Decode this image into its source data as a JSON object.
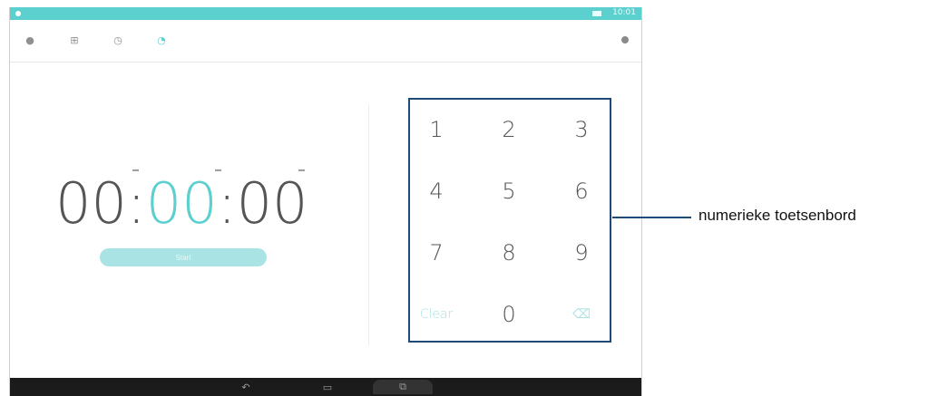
{
  "status_bar": {
    "time": "10:01"
  },
  "tabs": [
    {
      "name": "alarm",
      "icon": "alarm-icon",
      "glyph": "●"
    },
    {
      "name": "world-clock",
      "icon": "world-clock-icon",
      "glyph": "⊞"
    },
    {
      "name": "stopwatch",
      "icon": "stopwatch-icon",
      "glyph": "◷"
    },
    {
      "name": "timer",
      "icon": "timer-icon",
      "glyph": "◔",
      "active": true
    }
  ],
  "overflow_icon": "more-icon",
  "timer": {
    "hours": "00",
    "minutes": "00",
    "seconds": "00",
    "separator": ":",
    "start_label": "Start"
  },
  "keypad": {
    "keys": [
      "1",
      "2",
      "3",
      "4",
      "5",
      "6",
      "7",
      "8",
      "9",
      "Clear",
      "0",
      "⌫"
    ]
  },
  "nav": {
    "back": "↶",
    "home": "▭",
    "recents": "⧉"
  },
  "annotation": {
    "label": "numerieke toetsenbord"
  },
  "colors": {
    "accent": "#5ccfcf",
    "annotation_border": "#1e4a7a"
  }
}
